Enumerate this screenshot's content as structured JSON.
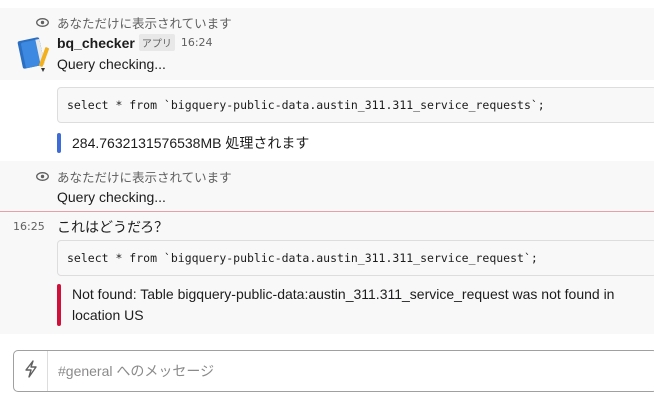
{
  "message1": {
    "visibility_note": "あなただけに表示されています",
    "author": "bq_checker",
    "badge": "アプリ",
    "time": "16:24",
    "text": "Query checking...",
    "code": "select * from `bigquery-public-data.austin_311.311_service_requests`;",
    "result": "284.7632131576538MB 処理されます",
    "result_color": "#3f6bd8"
  },
  "message2": {
    "visibility_note": "あなただけに表示されています",
    "text": "Query checking..."
  },
  "message3": {
    "time": "16:25",
    "text": "これはどうだろ？",
    "code": "select * from `bigquery-public-data.austin_311.311_service_request`;",
    "error_line1": "Not found: Table bigquery-public-data:austin_311.311_service_request was not found in",
    "error_line2": "location US",
    "error_color": "#d0103a"
  },
  "composer": {
    "placeholder": "#general へのメッセージ",
    "icon": "lightning-icon"
  }
}
